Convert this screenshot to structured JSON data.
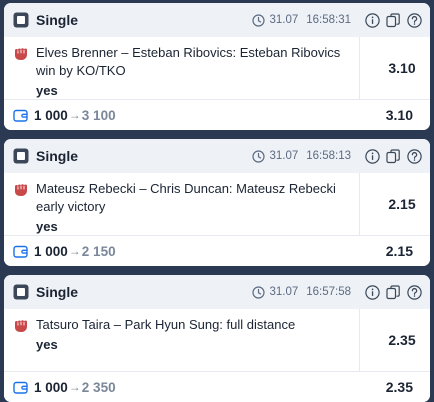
{
  "colors": {
    "background": "#2b3a52",
    "header_bg": "#eef1f5",
    "accent_blue": "#1a73e8",
    "fist_red": "#c9494a",
    "muted": "#7a879a"
  },
  "bets": [
    {
      "type_label": "Single",
      "date": "31.07",
      "time": "16:58:31",
      "event": "Elves Brenner – Esteban Ribovics: Esteban Ribovics win by KO/TKO",
      "outcome": "yes",
      "odds": "3.10",
      "stake": "1 000",
      "arrow": "→",
      "payout": "3 100",
      "total_odds": "3.10"
    },
    {
      "type_label": "Single",
      "date": "31.07",
      "time": "16:58:13",
      "event": "Mateusz Rebecki – Chris Duncan: Mateusz Rebecki early victory",
      "outcome": "yes",
      "odds": "2.15",
      "stake": "1 000",
      "arrow": "→",
      "payout": "2 150",
      "total_odds": "2.15"
    },
    {
      "type_label": "Single",
      "date": "31.07",
      "time": "16:57:58",
      "event": "Tatsuro Taira – Park Hyun Sung: full distance",
      "outcome": "yes",
      "odds": "2.35",
      "stake": "1 000",
      "arrow": "→",
      "payout": "2 350",
      "total_odds": "2.35"
    }
  ],
  "icons": {
    "type": "single-ticket-icon",
    "clock": "clock-icon",
    "info": "info-icon",
    "copy": "copy-icon",
    "help": "help-icon",
    "sport": "fist-icon",
    "wallet": "wallet-icon"
  }
}
